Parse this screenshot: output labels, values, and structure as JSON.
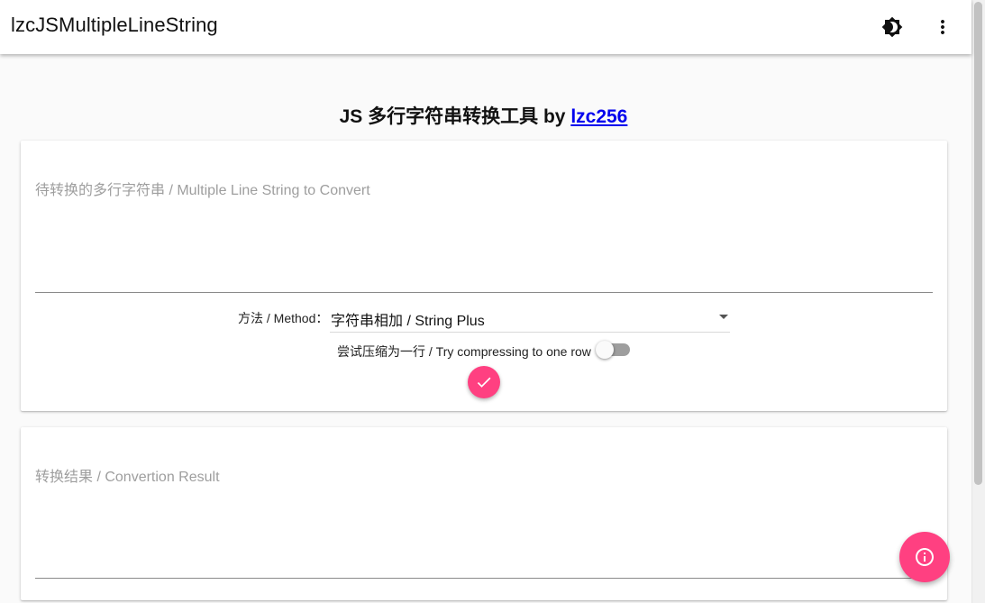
{
  "app": {
    "title": "lzcJSMultipleLineString"
  },
  "toolbar": {
    "theme_icon": "brightness-icon",
    "menu_icon": "more-vert-icon"
  },
  "headline": {
    "text": "JS 多行字符串转换工具 by ",
    "author": "lzc256"
  },
  "input": {
    "placeholder": "待转换的多行字符串 / Multiple Line String to Convert",
    "value": ""
  },
  "method": {
    "label": "方法 / Method：",
    "selected": "字符串相加 / String Plus"
  },
  "compress": {
    "label": "尝试压缩为一行 / Try compressing to one row",
    "enabled": false
  },
  "convert": {
    "icon": "check-icon"
  },
  "output": {
    "placeholder": "转换结果 / Convertion Result",
    "value": ""
  },
  "info": {
    "icon": "info-icon"
  },
  "colors": {
    "accent": "#ff4081",
    "link": "#0000ee"
  }
}
